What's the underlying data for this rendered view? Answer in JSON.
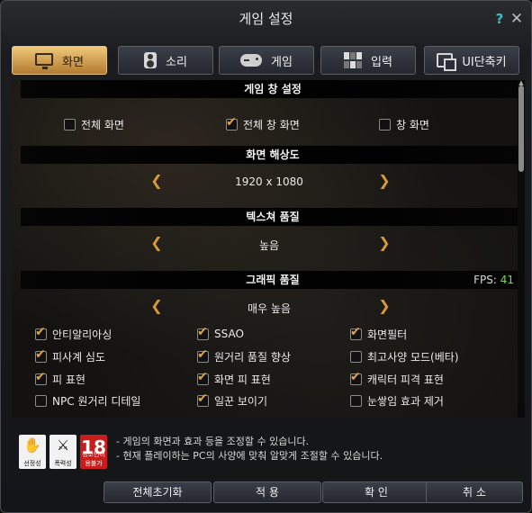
{
  "window": {
    "title": "게임 설정"
  },
  "tabs": [
    {
      "label": "화면",
      "icon": "monitor-icon",
      "active": true
    },
    {
      "label": "소리",
      "icon": "speaker-icon",
      "active": false
    },
    {
      "label": "게임",
      "icon": "gamepad-icon",
      "active": false
    },
    {
      "label": "입력",
      "icon": "grid-icon",
      "active": false
    },
    {
      "label": "UI단축키",
      "icon": "ui-icon",
      "active": false
    }
  ],
  "sections": {
    "window_mode": "게임 창 설정",
    "resolution": "화면 해상도",
    "texture": "텍스쳐 품질",
    "graphics": "그래픽 품질"
  },
  "window_mode": {
    "options": [
      {
        "label": "전체 화면",
        "checked": false
      },
      {
        "label": "전체 창 화면",
        "checked": true
      },
      {
        "label": "창 화면",
        "checked": false
      }
    ]
  },
  "resolution": {
    "value": "1920 x 1080"
  },
  "texture": {
    "value": "높음"
  },
  "graphics": {
    "value": "매우 높음",
    "fps_label": "FPS:",
    "fps_value": "41",
    "options": [
      {
        "label": "안티알리아싱",
        "checked": true
      },
      {
        "label": "SSAO",
        "checked": true
      },
      {
        "label": "화면필터",
        "checked": true
      },
      {
        "label": "피사계 심도",
        "checked": true
      },
      {
        "label": "원거리 품질 향상",
        "checked": true
      },
      {
        "label": "최고사양 모드(베타)",
        "checked": false
      },
      {
        "label": "피 표현",
        "checked": true
      },
      {
        "label": "화면 피 표현",
        "checked": true
      },
      {
        "label": "캐릭터 피격 표현",
        "checked": true
      },
      {
        "label": "NPC 원거리 디테일",
        "checked": false
      },
      {
        "label": "일꾼 보이기",
        "checked": true
      },
      {
        "label": "눈쌓임 효과 제거",
        "checked": false
      }
    ]
  },
  "ratings": [
    {
      "caption": "선정성"
    },
    {
      "caption": "폭력성"
    },
    {
      "symbol": "18",
      "caption": "청소년이용불가"
    }
  ],
  "info": {
    "line1": "- 게임의 화면과 효과 등을 조정할 수 있습니다.",
    "line2": "- 현재 플레이하는 PC의 사양에 맞춰 알맞게 조절할 수 있습니다."
  },
  "buttons": {
    "reset": "전체초기화",
    "apply": "적 용",
    "ok": "확 인",
    "cancel": "취 소"
  },
  "colors": {
    "accent": "#e2a341",
    "fps": "#7fd35a",
    "help": "#2cc2c9",
    "active_tab": "#f0c97a"
  }
}
